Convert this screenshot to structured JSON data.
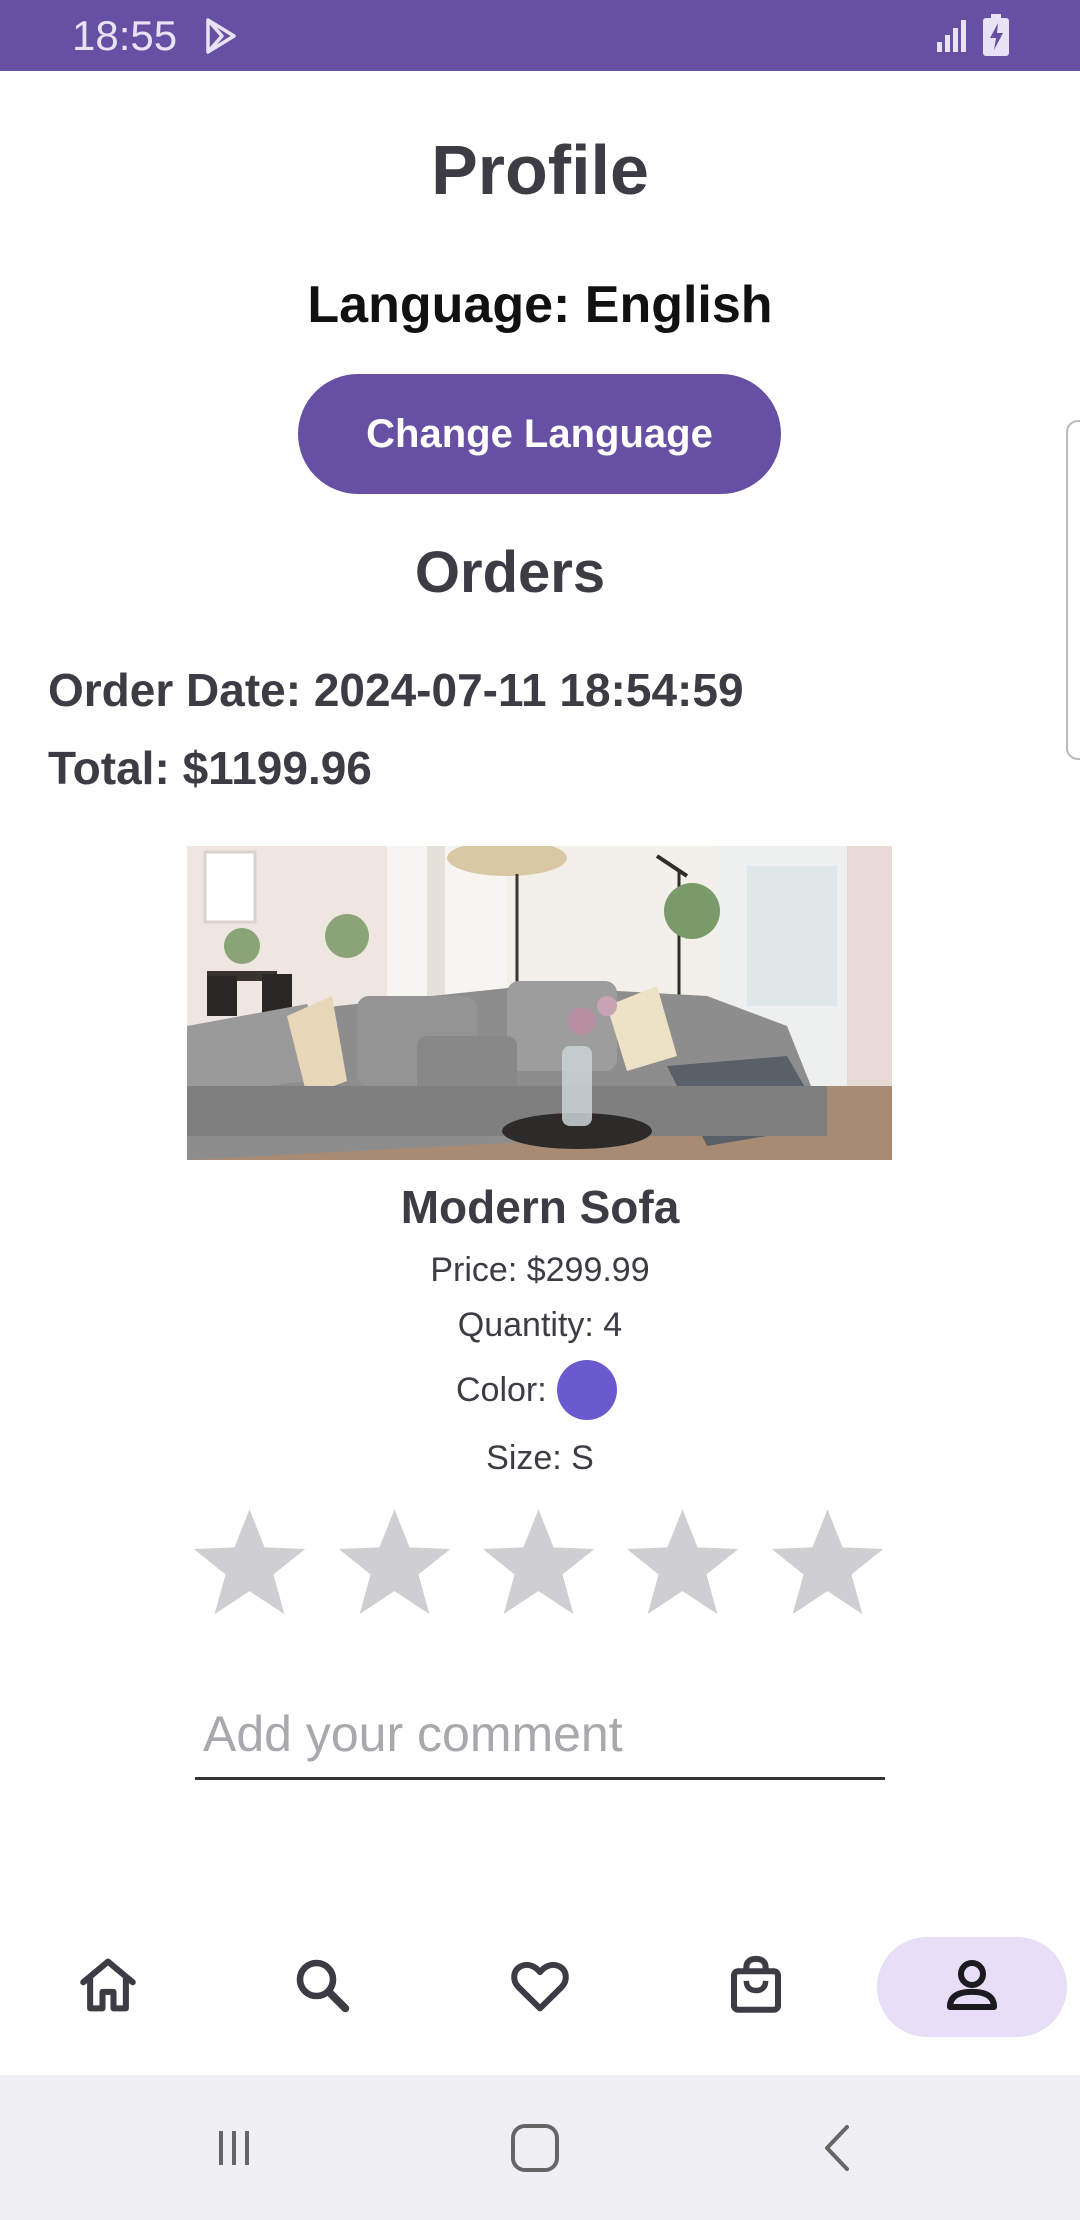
{
  "status_bar": {
    "time": "18:55",
    "background": "#6750a4"
  },
  "profile": {
    "title": "Profile",
    "language_label": "Language: English",
    "change_language_button": "Change Language"
  },
  "orders": {
    "heading": "Orders",
    "order_date": "Order Date: 2024-07-11 18:54:59",
    "total": "Total: $1199.96",
    "items": [
      {
        "name": "Modern Sofa",
        "price": "Price: $299.99",
        "quantity": "Quantity: 4",
        "color_label": "Color:",
        "color_value": "#6a5acd",
        "size": "Size: S",
        "rating": 0,
        "rating_max": 5,
        "comment_placeholder": "Add your comment"
      }
    ]
  },
  "bottom_nav": {
    "items": [
      {
        "icon": "home-icon"
      },
      {
        "icon": "search-icon"
      },
      {
        "icon": "heart-icon"
      },
      {
        "icon": "shopping-bag-icon"
      },
      {
        "icon": "profile-icon",
        "active": true
      }
    ],
    "active_color": "#e8def8"
  },
  "system_nav": {
    "icons": [
      "recent-apps-icon",
      "home-button-icon",
      "back-icon"
    ]
  },
  "colors": {
    "accent": "#6750a4",
    "star_inactive": "#cfcfd2"
  }
}
